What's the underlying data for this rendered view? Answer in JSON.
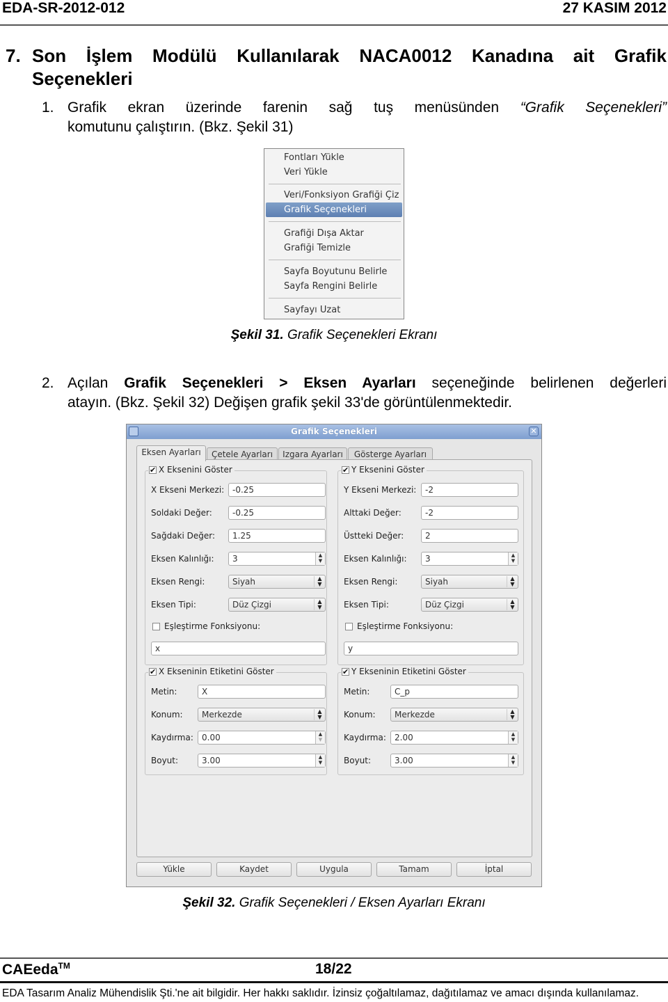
{
  "header": {
    "doc_id": "EDA-SR-2012-012",
    "date": "27 KASIM 2012"
  },
  "section": {
    "number": "7.",
    "title_line1": "Son İşlem Modülü Kullanılarak NACA0012 Kanadına ait Grafik",
    "title_line2": "Seçenekleri"
  },
  "steps": [
    {
      "number": "1.",
      "line1_pre": "Grafik ekran üzerinde farenin sağ tuş menüsünden ",
      "line1_italic": "“Grafik Seçenekleri”",
      "line2": "komutunu çalıştırın. (Bkz. Şekil 31)"
    },
    {
      "number": "2.",
      "line1_pre": "Açılan ",
      "line1_bold": "Grafik Seçenekleri > Eksen Ayarları",
      "line1_post": " seçeneğinde belirlenen değerleri",
      "line2": "atayın. (Bkz. Şekil 32) Değişen grafik şekil 33'de görüntülenmektedir."
    }
  ],
  "context_menu": {
    "items": [
      "Fontları Yükle",
      "Veri Yükle",
      "Veri/Fonksiyon Grafiği Çiz",
      "Grafik Seçenekleri",
      "Grafiği Dışa Aktar",
      "Grafiği Temizle",
      "Sayfa Boyutunu Belirle",
      "Sayfa Rengini Belirle",
      "Sayfayı Uzat"
    ],
    "highlighted_index": 3
  },
  "figure31": {
    "label": "Şekil 31.",
    "caption": " Grafik Seçenekleri Ekranı"
  },
  "dialog": {
    "title": "Grafik Seçenekleri",
    "tabs": [
      "Eksen Ayarları",
      "Çetele Ayarları",
      "Izgara Ayarları",
      "Gösterge Ayarları"
    ],
    "active_tab": 0,
    "x_axis": {
      "group_title": "X Eksenini Göster",
      "checked": true,
      "center_label": "X Ekseni Merkezi:",
      "center_value": "-0.25",
      "min_label": "Soldaki Değer:",
      "min_value": "-0.25",
      "max_label": "Sağdaki Değer:",
      "max_value": "1.25",
      "thickness_label": "Eksen Kalınlığı:",
      "thickness_value": "3",
      "color_label": "Eksen Rengi:",
      "color_value": "Siyah",
      "type_label": "Eksen Tipi:",
      "type_value": "Düz Çizgi",
      "mapping_label": "Eşleştirme Fonksiyonu:",
      "mapping_checked": false,
      "mapping_value": "x"
    },
    "y_axis": {
      "group_title": "Y Eksenini Göster",
      "checked": true,
      "center_label": "Y Ekseni Merkezi:",
      "center_value": "-2",
      "min_label": "Alttaki Değer:",
      "min_value": "-2",
      "max_label": "Üstteki Değer:",
      "max_value": "2",
      "thickness_label": "Eksen Kalınlığı:",
      "thickness_value": "3",
      "color_label": "Eksen Rengi:",
      "color_value": "Siyah",
      "type_label": "Eksen Tipi:",
      "type_value": "Düz Çizgi",
      "mapping_label": "Eşleştirme Fonksiyonu:",
      "mapping_checked": false,
      "mapping_value": "y"
    },
    "x_label": {
      "group_title": "X Ekseninin Etiketini Göster",
      "checked": true,
      "text_label": "Metin:",
      "text_value": "X",
      "position_label": "Konum:",
      "position_value": "Merkezde",
      "offset_label": "Kaydırma:",
      "offset_value": "0.00",
      "size_label": "Boyut:",
      "size_value": "3.00"
    },
    "y_label": {
      "group_title": "Y Ekseninin Etiketini Göster",
      "checked": true,
      "text_label": "Metin:",
      "text_value": "C_p",
      "position_label": "Konum:",
      "position_value": "Merkezde",
      "offset_label": "Kaydırma:",
      "offset_value": "2.00",
      "size_label": "Boyut:",
      "size_value": "3.00"
    },
    "buttons": [
      "Yükle",
      "Kaydet",
      "Uygula",
      "Tamam",
      "İptal"
    ]
  },
  "figure32": {
    "label": "Şekil 32.",
    "caption": " Grafik Seçenekleri / Eksen Ayarları Ekranı"
  },
  "footer": {
    "brand": "CAEeda",
    "trademark": "TM",
    "page": "18/22",
    "notice": "EDA Tasarım Analiz Mühendislik Şti.'ne ait bilgidir. Her hakkı saklıdır. İzinsiz çoğaltılamaz, dağıtılamaz ve amacı dışında kullanılamaz."
  },
  "colors": {
    "menu_highlight": "#6a8bbd",
    "titlebar": "#8eaad7",
    "dialog_bg": "#e6e6e6"
  }
}
